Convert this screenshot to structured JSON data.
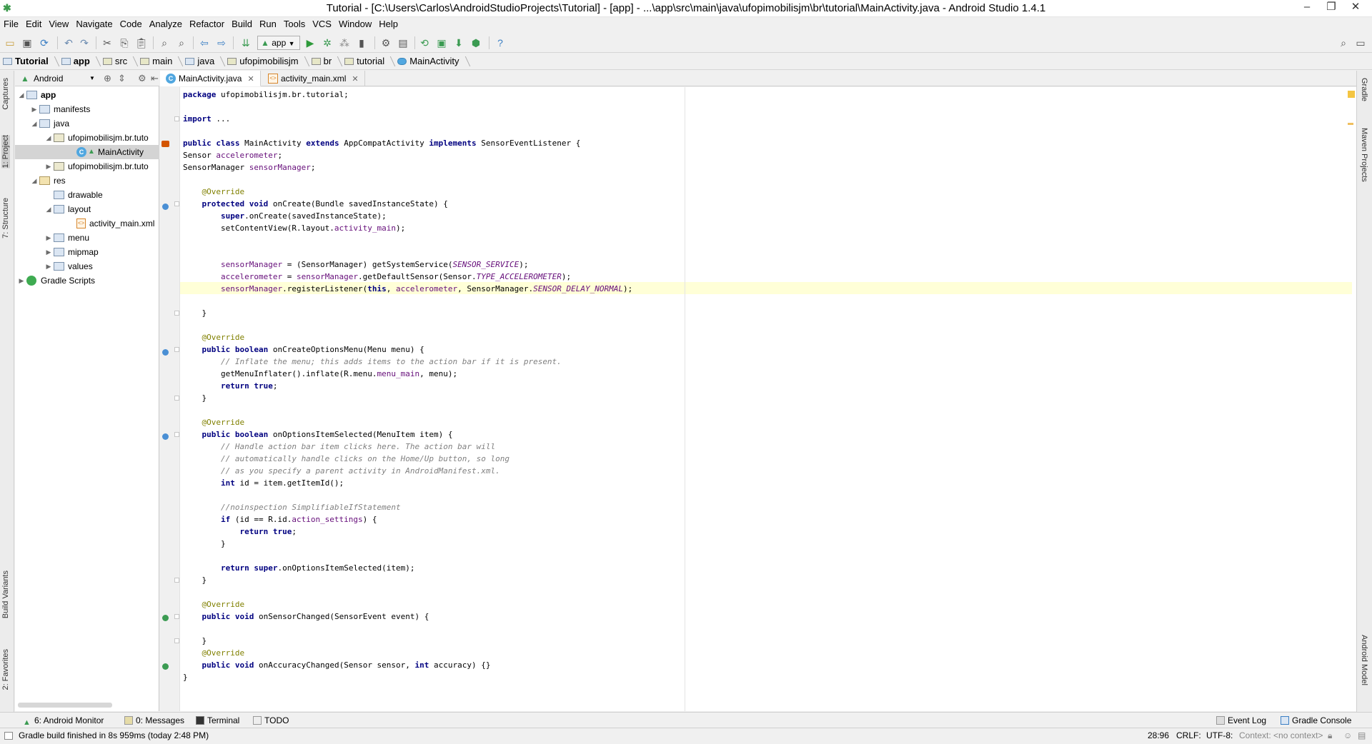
{
  "window": {
    "title": "Tutorial - [C:\\Users\\Carlos\\AndroidStudioProjects\\Tutorial] - [app] - ...\\app\\src\\main\\java\\ufopimobilisjm\\br\\tutorial\\MainActivity.java - Android Studio 1.4.1"
  },
  "menubar": [
    "File",
    "Edit",
    "View",
    "Navigate",
    "Code",
    "Analyze",
    "Refactor",
    "Build",
    "Run",
    "Tools",
    "VCS",
    "Window",
    "Help"
  ],
  "toolbar": {
    "run_config": "app"
  },
  "breadcrumb": [
    "Tutorial",
    "app",
    "src",
    "main",
    "java",
    "ufopimobilisjm",
    "br",
    "tutorial",
    "MainActivity"
  ],
  "left_stripe": {
    "captures": "Captures",
    "project": "1: Project",
    "structure": "7: Structure",
    "build_variants": "Build Variants",
    "favorites": "2: Favorites"
  },
  "right_stripe": {
    "gradle": "Gradle",
    "maven": "Maven Projects",
    "android_model": "Android Model"
  },
  "project_panel": {
    "view_mode": "Android",
    "tree": [
      {
        "label": "app",
        "bold": true
      },
      {
        "label": "manifests"
      },
      {
        "label": "java"
      },
      {
        "label": "ufopimobilisjm.br.tuto"
      },
      {
        "label": "MainActivity"
      },
      {
        "label": "ufopimobilisjm.br.tuto"
      },
      {
        "label": "res"
      },
      {
        "label": "drawable"
      },
      {
        "label": "layout"
      },
      {
        "label": "activity_main.xml"
      },
      {
        "label": "menu"
      },
      {
        "label": "mipmap"
      },
      {
        "label": "values"
      },
      {
        "label": "Gradle Scripts"
      }
    ]
  },
  "editor_tabs": [
    {
      "label": "MainActivity.java",
      "active": true
    },
    {
      "label": "activity_main.xml",
      "active": false
    }
  ],
  "code_lines": [
    "package ufopimobilisjm.br.tutorial;",
    "",
    "import ...",
    "",
    "public class MainActivity extends AppCompatActivity implements SensorEventListener {",
    "Sensor accelerometer;",
    "SensorManager sensorManager;",
    "",
    "    @Override",
    "    protected void onCreate(Bundle savedInstanceState) {",
    "        super.onCreate(savedInstanceState);",
    "        setContentView(R.layout.activity_main);",
    "",
    "",
    "        sensorManager = (SensorManager) getSystemService(SENSOR_SERVICE);",
    "        accelerometer = sensorManager.getDefaultSensor(Sensor.TYPE_ACCELEROMETER);",
    "        sensorManager.registerListener(this, accelerometer, SensorManager.SENSOR_DELAY_NORMAL);",
    "",
    "    }",
    "",
    "    @Override",
    "    public boolean onCreateOptionsMenu(Menu menu) {",
    "        // Inflate the menu; this adds items to the action bar if it is present.",
    "        getMenuInflater().inflate(R.menu.menu_main, menu);",
    "        return true;",
    "    }",
    "",
    "    @Override",
    "    public boolean onOptionsItemSelected(MenuItem item) {",
    "        // Handle action bar item clicks here. The action bar will",
    "        // automatically handle clicks on the Home/Up button, so long",
    "        // as you specify a parent activity in AndroidManifest.xml.",
    "        int id = item.getItemId();",
    "",
    "        //noinspection SimplifiableIfStatement",
    "        if (id == R.id.action_settings) {",
    "            return true;",
    "        }",
    "",
    "        return super.onOptionsItemSelected(item);",
    "    }",
    "",
    "    @Override",
    "    public void onSensorChanged(SensorEvent event) {",
    "",
    "    }",
    "    @Override",
    "    public void onAccuracyChanged(Sensor sensor, int accuracy) {}",
    "}"
  ],
  "bottom_tabs": {
    "android_monitor": "6: Android Monitor",
    "messages": "0: Messages",
    "terminal": "Terminal",
    "todo": "TODO",
    "event_log": "Event Log",
    "gradle_console": "Gradle Console"
  },
  "status": {
    "message": "Gradle build finished in 8s 959ms (today 2:48 PM)",
    "position": "28:96",
    "line_sep": "CRLF:",
    "encoding": "UTF-8:",
    "context": "Context: <no context>"
  }
}
